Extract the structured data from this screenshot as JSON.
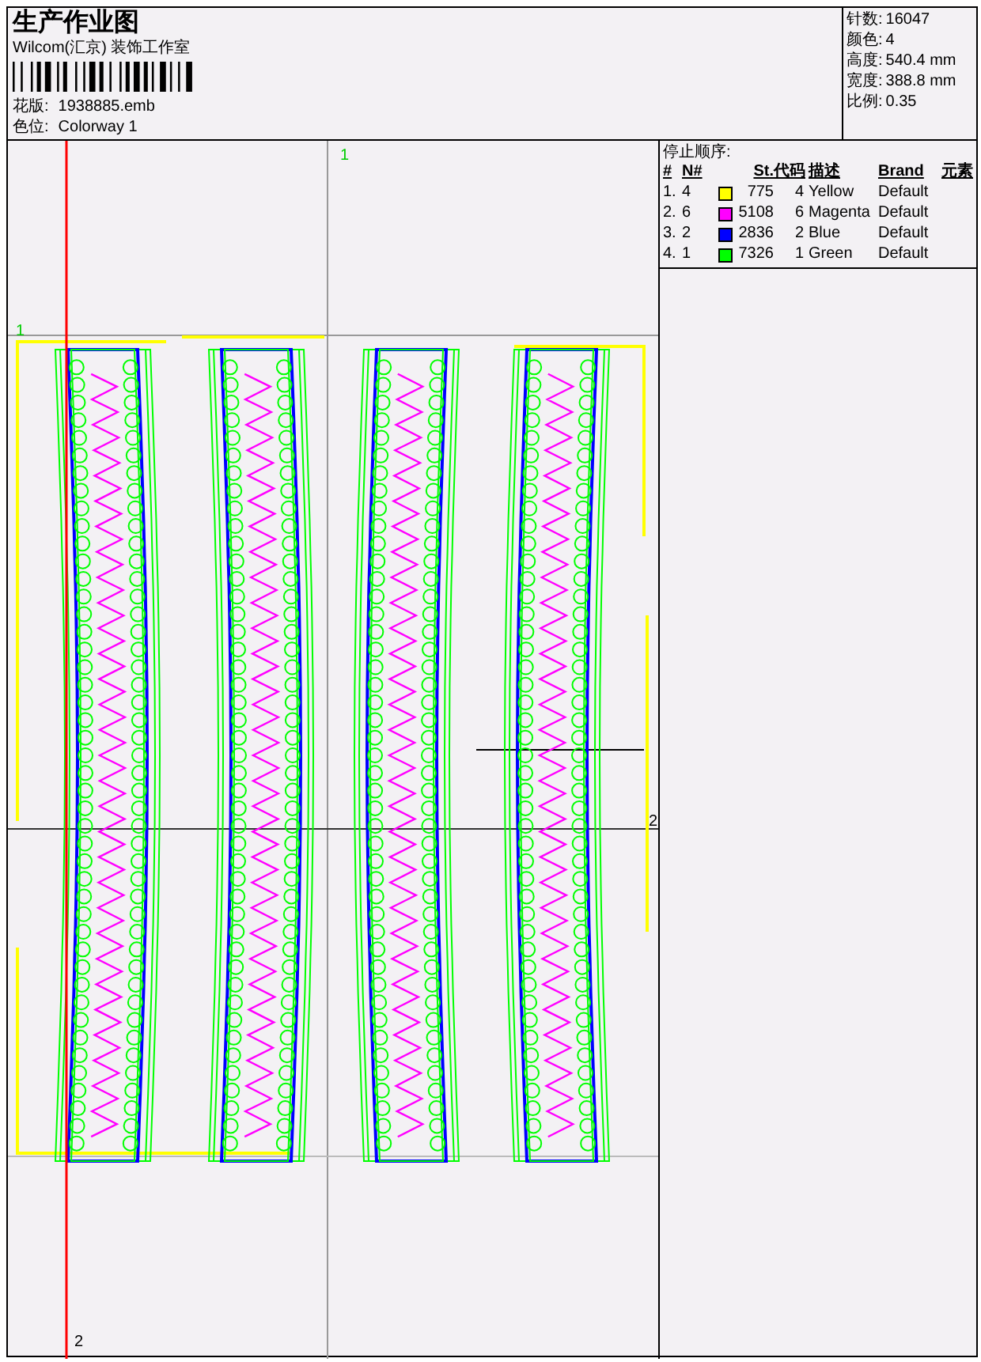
{
  "header": {
    "title": "生产作业图",
    "company": "Wilcom(汇京) 装饰工作室",
    "fields": [
      {
        "label": "花版:",
        "value": "1938885.emb"
      },
      {
        "label": "色位:",
        "value": "Colorway 1"
      }
    ],
    "stats": [
      {
        "label": "针数:",
        "value": "16047"
      },
      {
        "label": "颜色:",
        "value": "4"
      },
      {
        "label": "高度:",
        "value": "540.4 mm"
      },
      {
        "label": "宽度:",
        "value": "388.8 mm"
      },
      {
        "label": "比例:",
        "value": "0.35"
      }
    ]
  },
  "stop_sequence": {
    "title": "停止顺序:",
    "columns": [
      "#",
      "N#",
      "St.",
      "代码",
      "描述",
      "Brand",
      "元素"
    ],
    "rows": [
      {
        "index": "1.",
        "needle": "4",
        "color": "#ffff00",
        "stitches": "775",
        "code": "4",
        "description": "Yellow",
        "brand": "Default"
      },
      {
        "index": "2.",
        "needle": "6",
        "color": "#ff00ff",
        "stitches": "5108",
        "code": "6",
        "description": "Magenta",
        "brand": "Default"
      },
      {
        "index": "3.",
        "needle": "2",
        "color": "#0000ff",
        "stitches": "2836",
        "code": "2",
        "description": "Blue",
        "brand": "Default"
      },
      {
        "index": "4.",
        "needle": "1",
        "color": "#00ff00",
        "stitches": "7326",
        "code": "1",
        "description": "Green",
        "brand": "Default"
      }
    ]
  },
  "canvas": {
    "markers": [
      {
        "label": "1"
      },
      {
        "label": "1"
      },
      {
        "label": "2"
      },
      {
        "label": "2"
      }
    ]
  }
}
